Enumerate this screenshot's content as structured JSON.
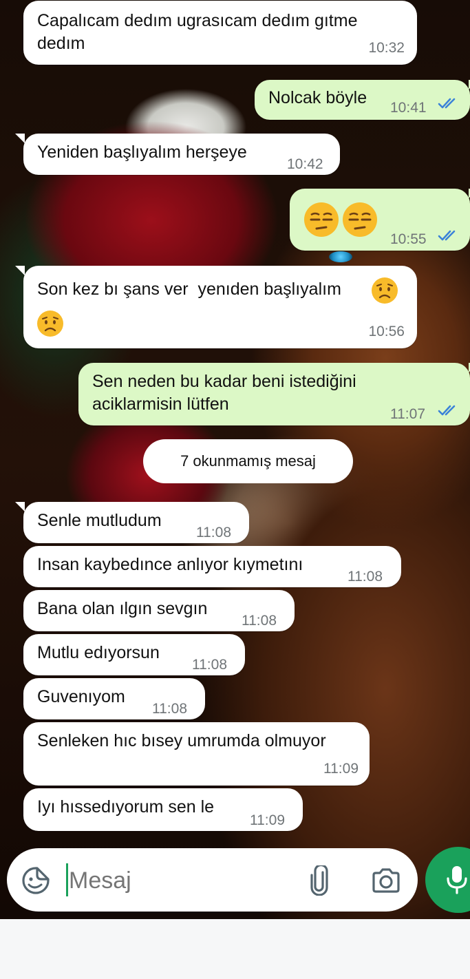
{
  "messages": [
    {
      "text": "Capalıcam dedım ugrasıcam dedım gıtme\ndedım",
      "time": "10:32",
      "direction": "incoming"
    },
    {
      "text": "Nolcak böyle",
      "time": "10:41",
      "direction": "outgoing",
      "status": "read"
    },
    {
      "text": "Yeniden başlıyalım herşeye",
      "time": "10:42",
      "direction": "incoming"
    },
    {
      "text": "",
      "emoji": [
        "unamused-face",
        "unamused-face"
      ],
      "time": "10:55",
      "direction": "outgoing",
      "status": "read"
    },
    {
      "text": "Son kez bı şans ver  yenıden başlıyalım",
      "emoji": [
        "worried-face",
        "worried-face"
      ],
      "time": "10:56",
      "direction": "incoming"
    },
    {
      "text": "Sen neden bu kadar beni istediğini\naciklarmisin lütfen",
      "time": "11:07",
      "direction": "outgoing",
      "status": "read"
    },
    {
      "text": "Senle mutludum",
      "time": "11:08",
      "direction": "incoming"
    },
    {
      "text": "Insan kaybedınce anlıyor kıymetını",
      "time": "11:08",
      "direction": "incoming"
    },
    {
      "text": "Bana olan ılgın sevgın",
      "time": "11:08",
      "direction": "incoming"
    },
    {
      "text": "Mutlu edıyorsun",
      "time": "11:08",
      "direction": "incoming"
    },
    {
      "text": "Guvenıyom",
      "time": "11:08",
      "direction": "incoming"
    },
    {
      "text": "Senleken hıc bısey umrumda olmuyor",
      "time": "11:09",
      "direction": "incoming"
    },
    {
      "text": "Iyı hıssedıyorum sen le",
      "time": "11:09",
      "direction": "incoming"
    }
  ],
  "unread_banner": "7 okunmamış mesaj",
  "composer": {
    "placeholder": "Mesaj",
    "icons": [
      "sticker-icon",
      "attachment-icon",
      "camera-icon",
      "microphone-icon"
    ]
  },
  "colors": {
    "incoming_bubble": "#ffffff",
    "outgoing_bubble": "#dcf8c6",
    "read_ticks": "#3b82d8",
    "mic_button": "#1aa15b",
    "cursor": "#1aa15b"
  }
}
